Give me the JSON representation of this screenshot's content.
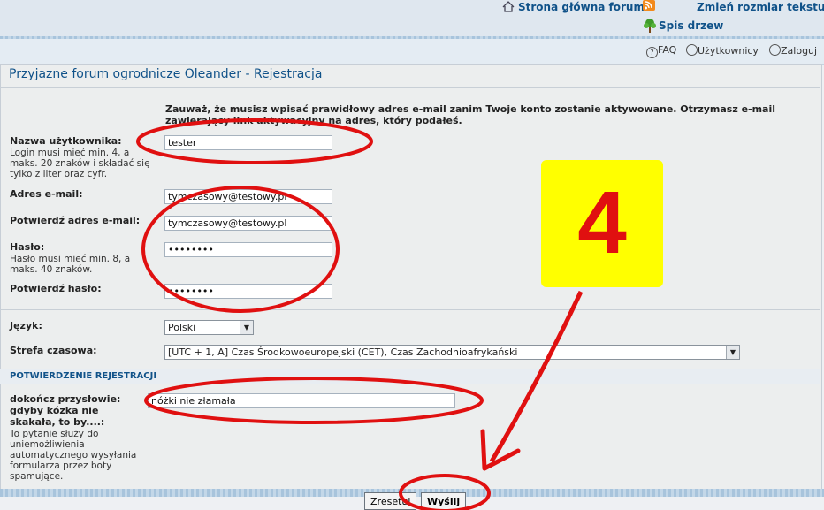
{
  "header": {
    "home_link": "Strona główna forum",
    "font_size_link": "Zmień rozmiar tekstu",
    "trees_link": "Spis drzew",
    "menu": {
      "faq": "FAQ",
      "users": "Użytkownicy",
      "login": "Zaloguj"
    }
  },
  "page_title": "Przyjazne forum ogrodnicze Oleander - Rejestracja",
  "notice": "Zauważ, że musisz wpisać prawidłowy adres e-mail zanim Twoje konto zostanie aktywowane. Otrzymasz e-mail zawierający link aktywacyjny na adres, który podałeś.",
  "form": {
    "username_label": "Nazwa użytkownika:",
    "username_hint": "Login musi mieć min. 4, a maks. 20 znaków i składać się tylko z liter oraz cyfr.",
    "username_value": "tester",
    "email_label": "Adres e-mail:",
    "email_value": "tymczasowy@testowy.pl",
    "email_confirm_label": "Potwierdź adres e-mail:",
    "email_confirm_value": "tymczasowy@testowy.pl",
    "password_label": "Hasło:",
    "password_hint": "Hasło musi mieć min. 8, a maks. 40 znaków.",
    "password_value": "••••••••",
    "password_confirm_label": "Potwierdź hasło:",
    "password_confirm_value": "••••••••",
    "language_label": "Język:",
    "language_value": "Polski",
    "timezone_label": "Strefa czasowa:",
    "timezone_value": "[UTC + 1, A] Czas Środkowoeuropejski (CET), Czas Zachodnioafrykański"
  },
  "confirmation": {
    "section_title": "POTWIERDZENIE REJESTRACJI",
    "question_label": "dokończ przysłowie: gdyby kózka nie skakała, to by....:",
    "question_hint": "To pytanie służy do uniemożliwienia automatycznego wysyłania formularza przez boty spamujące.",
    "answer_value": "nóżki nie złamała"
  },
  "buttons": {
    "reset": "Zresetuj",
    "submit": "Wyślij"
  },
  "annotation": {
    "step_number": "4",
    "ellipse_color": "#e01010",
    "box_color": "#ffff00"
  }
}
